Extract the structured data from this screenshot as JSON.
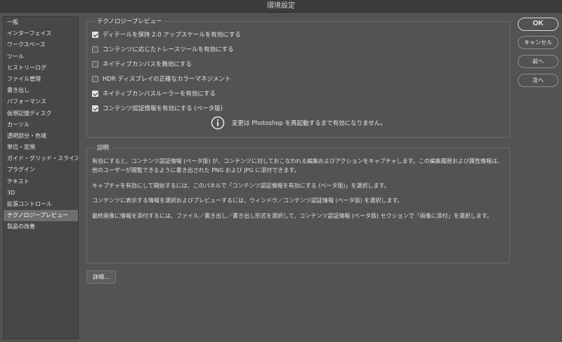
{
  "window": {
    "title": "環境設定"
  },
  "sidebar": {
    "items": [
      {
        "label": "一般"
      },
      {
        "label": "インターフェイス"
      },
      {
        "label": "ワークスペース"
      },
      {
        "label": "ツール"
      },
      {
        "label": "ヒストリーログ"
      },
      {
        "label": "ファイル管理"
      },
      {
        "label": "書き出し"
      },
      {
        "label": "パフォーマンス"
      },
      {
        "label": "仮想記憶ディスク"
      },
      {
        "label": "カーソル"
      },
      {
        "label": "透明部分・色域"
      },
      {
        "label": "単位・定規"
      },
      {
        "label": "ガイド・グリッド・スライス"
      },
      {
        "label": "プラグイン"
      },
      {
        "label": "テキスト"
      },
      {
        "label": "3D"
      },
      {
        "label": "拡張コントロール"
      },
      {
        "label": "テクノロジープレビュー"
      },
      {
        "label": "製品の改善"
      }
    ],
    "selected_label": "テクノロジープレビュー"
  },
  "tech_preview": {
    "title": "テクノロジープレビュー",
    "options": [
      {
        "label": "ディテールを保持 2.0 アップスケールを有効にする",
        "checked": true
      },
      {
        "label": "コンテンツに応じたトレースツールを有効にする",
        "checked": false
      },
      {
        "label": "ネイティブカンバスを無効にする",
        "checked": false
      },
      {
        "label": "HDR ディスプレイの正確なカラーマネジメント",
        "checked": false
      },
      {
        "label": "ネイティブカンバスルーラーを有効にする",
        "checked": true
      },
      {
        "label": "コンテンツ認証情報を有効にする (ベータ版)",
        "checked": true
      }
    ],
    "info_message": "変更は Photoshop を再起動するまで有効になりません。"
  },
  "description": {
    "title": "説明",
    "paragraphs": [
      "有効にすると、コンテンツ認証情報 (ベータ版) が、コンテンツに対しておこなわれる編集およびアクションをキャプチャします。この編集履歴および属性情報は、他のユーザーが閲覧できるように書き出された PNG および JPG に添付できます。",
      "キャプチャを有効にして開始するには、このパネルで「コンテンツ認証情報を有効にする (ベータ版)」を選択します。",
      "コンテンツに表示する情報を選択およびプレビューするには、ウィンドウ／コンテンツ認証情報 (ベータ版) を選択します。",
      "最終画像に情報を添付するには、ファイル／書き出し／書き出し形式を選択して、コンテンツ認証情報 (ベータ版) セクションで「画像に添付」を選択します。"
    ]
  },
  "buttons": {
    "ok": "OK",
    "cancel": "キャンセル",
    "prev": "前へ",
    "next": "次へ",
    "details": "詳細..."
  },
  "icons": {
    "info": "info-circle-icon",
    "check": "checkmark-icon"
  },
  "colors": {
    "background": "#535353",
    "sidebar": "#474747",
    "selected": "#6e6e6e",
    "text": "#e6e6e6"
  }
}
